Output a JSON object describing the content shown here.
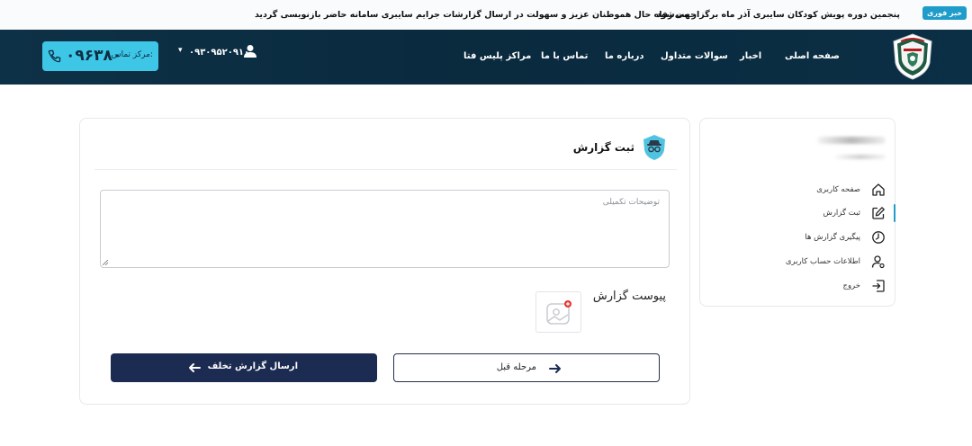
{
  "ticker": {
    "badge": "خبر فوری",
    "items": [
      "پنجمین دوره پویش کودکان سایبری آذر ماه برگزار می‌شود",
      "جهت رفاه حال هموطنان عزیز و سهولت در ارسال گزارشات جرایم سایبری سامانه حاضر بازنویسی گردید"
    ]
  },
  "header": {
    "nav": [
      "صفحه اصلی",
      "اخبار",
      "سوالات متداول",
      "درباره ما",
      "تماس با ما",
      "مراکز پلیس فتا"
    ],
    "user_phone": "۰۹۳۰۹۵۲۰۹۱۰",
    "support_label": "مرکز تماس:",
    "support_number": "۰۹۶۳۸۰"
  },
  "sidebar": {
    "items": [
      {
        "label": "صفحه کاربری",
        "icon": "home-icon",
        "active": false
      },
      {
        "label": "ثبت گزارش",
        "icon": "edit-icon",
        "active": true
      },
      {
        "label": "پیگیری گزارش ها",
        "icon": "clock-icon",
        "active": false
      },
      {
        "label": "اطلاعات حساب کاربری",
        "icon": "user-settings-icon",
        "active": false
      },
      {
        "label": "خروج",
        "icon": "logout-icon",
        "active": false
      }
    ]
  },
  "form": {
    "title": "ثبت گزارش",
    "description_placeholder": "توضیحات تکمیلی",
    "attachment_label": "پیوست گزارش",
    "prev_button": "مرحله قبل",
    "submit_button": "ارسال گزارش تخلف"
  },
  "colors": {
    "header_bg": "#0b2f45",
    "accent": "#3ec6e6",
    "submit_bg": "#1c2b52"
  }
}
